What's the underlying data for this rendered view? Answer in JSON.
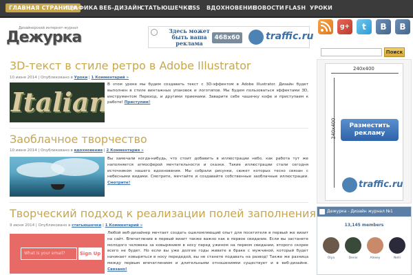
{
  "nav": {
    "items": [
      "ГЛАВНАЯ СТРАНИЦА",
      "ГРАФИКА",
      "ВЕБ-ДИЗАЙН",
      "СТАТЬЮШЕЧКИ",
      "CSS",
      "ВДОХНОВЕНИЕ",
      "НОВОСТИ",
      "FLASH",
      "УРОКИ"
    ],
    "active_index": 0
  },
  "logo": {
    "tagline": "Дизайнерский интернет-журнал",
    "name": "Дежурка"
  },
  "banner": {
    "text": "Здесь может быть ваша реклама",
    "size": "468x60",
    "brand": "traffic.ru"
  },
  "posts": [
    {
      "title": "3D-текст в стиле ретро в Adobe Illustrator",
      "meta_date": "10 июня 2014 | Опубликовано в",
      "meta_cat": "Уроки",
      "meta_comments": "1 Комментарий »",
      "thumb_word": "Italian",
      "excerpt": "В этом уроке мы будем создавать текст с 3D-эффектом в Adobe Illustrator. Дизайн будет выполнен в стиле винтажных упаковок и логотипов. Мы будем пользоваться эффектами 3D, инструментом Переход, и другими приемами. Заварите себе чашечку кофе и приступаем к работе!",
      "more": "Приступим!"
    },
    {
      "title": "Заоблачное творчество",
      "meta_date": "10 июня 2014 | Опубликовано в",
      "meta_cat": "вдохновение",
      "meta_comments": "2 Комментария »",
      "excerpt": "Вы замечали когда-нибудь, что стоит добавить в иллюстрации небо, как работа тут же наполняется атмосферой мечтательности и сказки. Такие иллюстрации стали сегодня источником нашего вдохновения. Мы собрали рисунки, сюжет которых тесно связан с небесными видами. Смотрите, мечтайте и создавайте собственные заоблачные иллюстрации.",
      "more": "Смотрите!"
    },
    {
      "title": "Творческий подход к реализации полей заполнения",
      "meta_date": "9 июня 2014 | Опубликовано в",
      "meta_cat": "статьюшечки",
      "meta_comments": "1 Комментарий »",
      "form_placeholder": "What is your email?",
      "form_button": "Sign Up",
      "excerpt": "Любой веб-дизайнер мечтает создать ошеломляющий опыт для посетителя в первый же визит на сайт. Впечатление в первый визит также важно как в первое свидание. Если вы застанете молодого человека за ковырянием в носу перед ужином на первом свидании, второго скорее всего не будет. Но если вы уже долгие годы живете в браке с мужчиной, который будет начинает ковыряться в носу передедой, вы не станете подавать на развод! Также же разница между первым впечатлением и длительными отношениями существует и в веб-дизайне.",
      "more": "Связано!"
    }
  ],
  "sidebar": {
    "social": [
      "RSS",
      "g+",
      "t",
      "B",
      "B"
    ],
    "search_button": "Поиск",
    "ad": {
      "width_label": "240x400",
      "height_label": "240x400",
      "cta": "Разместить рекламу",
      "brand": "traffic.ru"
    },
    "vk": {
      "header": "Дежурка - Дизайн журнал №1",
      "members": "13,145 members",
      "people": [
        "Olya",
        "Denis",
        "Alexey",
        "Nelli"
      ]
    }
  },
  "colors": {
    "accent": "#c8a64a",
    "link": "#3a6fa8",
    "nav_bg": "#3b3b3b"
  }
}
